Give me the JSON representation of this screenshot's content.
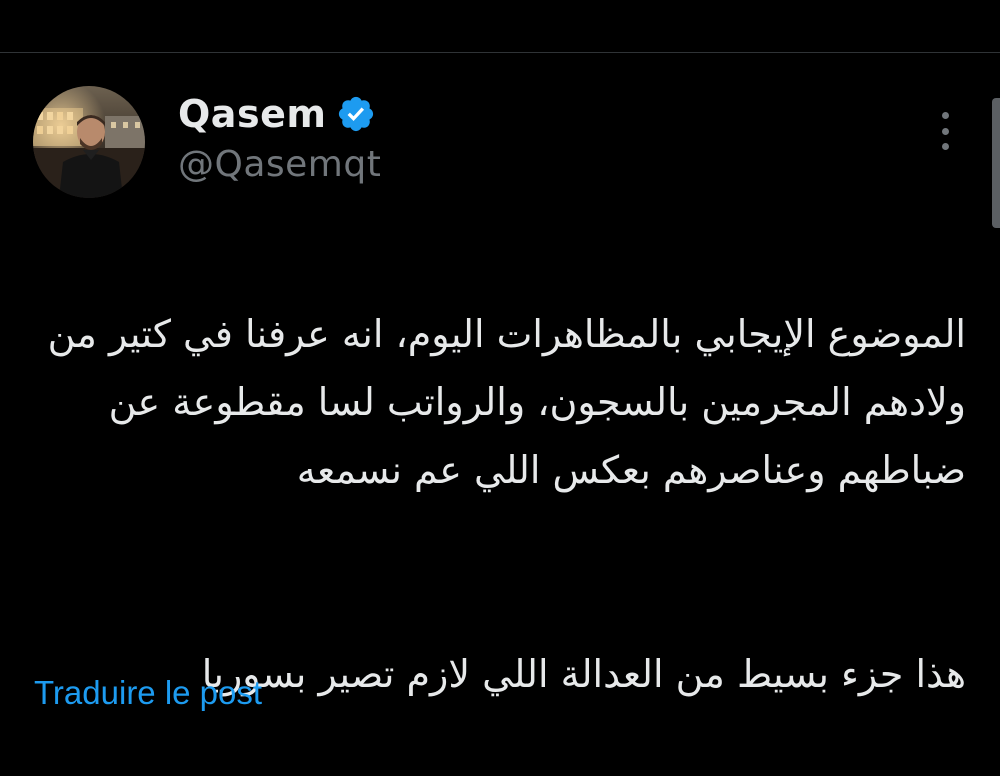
{
  "tweet": {
    "author": {
      "display_name": "Qasem",
      "handle": "@Qasemqt",
      "verified": true,
      "avatar_icon": "user-avatar-photo"
    },
    "text_paragraph_1": "الموضوع الإيجابي بالمظاهرات اليوم، انه عرفنا في كتير من ولادهم المجرمين بالسجون، والرواتب لسا مقطوعة عن ضباطهم وعناصرهم بعكس اللي عم نسمعه",
    "text_paragraph_2": "هذا جزء بسيط من العدالة اللي لازم تصير بسوريا",
    "translate_label": "Traduire le post",
    "more_icon": "more-vertical-icon",
    "verified_icon": "verified-badge-icon"
  },
  "colors": {
    "background": "#000000",
    "text_primary": "#e7e9ea",
    "text_secondary": "#71767b",
    "accent": "#1d9bf0",
    "verified": "#1d9bf0"
  }
}
